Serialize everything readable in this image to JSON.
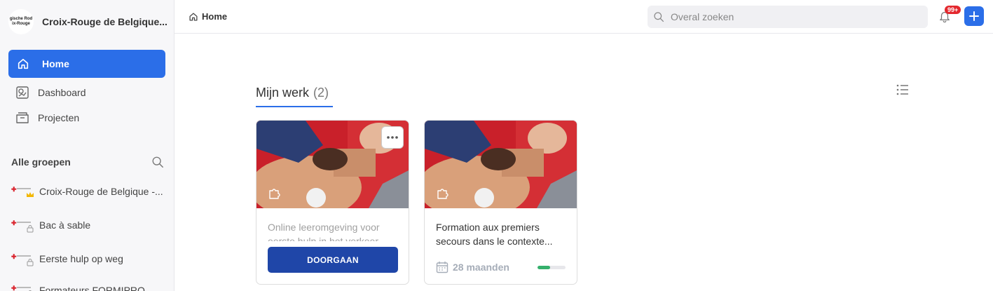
{
  "brand": {
    "logo_text_line1": "gische Rod",
    "logo_text_line2": "ix-Rouge",
    "name": "Croix-Rouge de Belgique..."
  },
  "nav": {
    "home": "Home",
    "dashboard": "Dashboard",
    "projects": "Projecten"
  },
  "groups": {
    "heading": "Alle groepen",
    "items": [
      {
        "label": "Croix-Rouge de Belgique -...",
        "badge": "crown-icon"
      },
      {
        "label": "Bac à sable",
        "badge": "lock-icon"
      },
      {
        "label": "Eerste hulp op weg",
        "badge": "lock-icon"
      },
      {
        "label": "Formateurs FORMIPRO",
        "badge": "lock-icon"
      }
    ]
  },
  "topbar": {
    "breadcrumb": "Home",
    "search_placeholder": "Overal zoeken",
    "notification_count": "99+"
  },
  "main": {
    "section_title": "Mijn werk",
    "section_count": "(2)",
    "cards": [
      {
        "title": "Online leeromgeving voor eerste hulp in het verkeer",
        "button": "DOORGAAN"
      },
      {
        "title": "Formation aux premiers secours dans le contexte...",
        "duration": "28 maanden",
        "progress": 0.45
      }
    ]
  },
  "colors": {
    "accent": "#2b6ee8",
    "button_dark": "#1f46a8",
    "badge_red": "#e3282e",
    "progress_green": "#35b06c"
  }
}
